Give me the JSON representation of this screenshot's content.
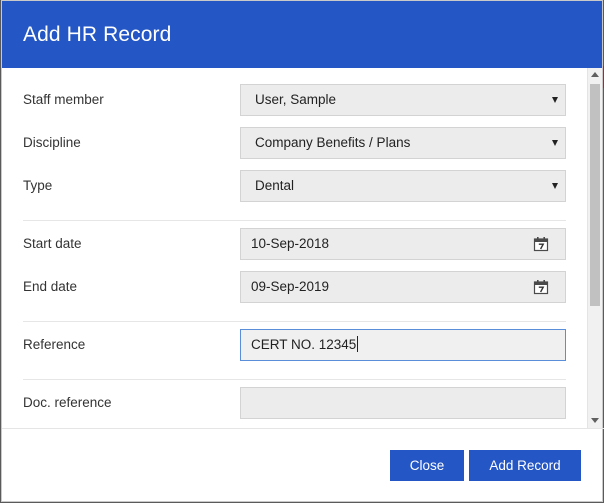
{
  "dialog": {
    "title": "Add HR Record"
  },
  "form": {
    "staff_member": {
      "label": "Staff member",
      "value": "User, Sample"
    },
    "discipline": {
      "label": "Discipline",
      "value": "Company Benefits / Plans"
    },
    "type": {
      "label": "Type",
      "value": "Dental"
    },
    "start_date": {
      "label": "Start date",
      "value": "10-Sep-2018",
      "icon": "calendar-icon"
    },
    "end_date": {
      "label": "End date",
      "value": "09-Sep-2019",
      "icon": "calendar-icon"
    },
    "reference": {
      "label": "Reference",
      "value": "CERT NO. 12345"
    },
    "doc_reference": {
      "label": "Doc. reference",
      "value": ""
    }
  },
  "footer": {
    "close_label": "Close",
    "add_label": "Add Record"
  },
  "colors": {
    "header": "#2457c5",
    "button": "#2457c5",
    "field_bg": "#ececec",
    "focus_border": "#5b8ed8"
  }
}
